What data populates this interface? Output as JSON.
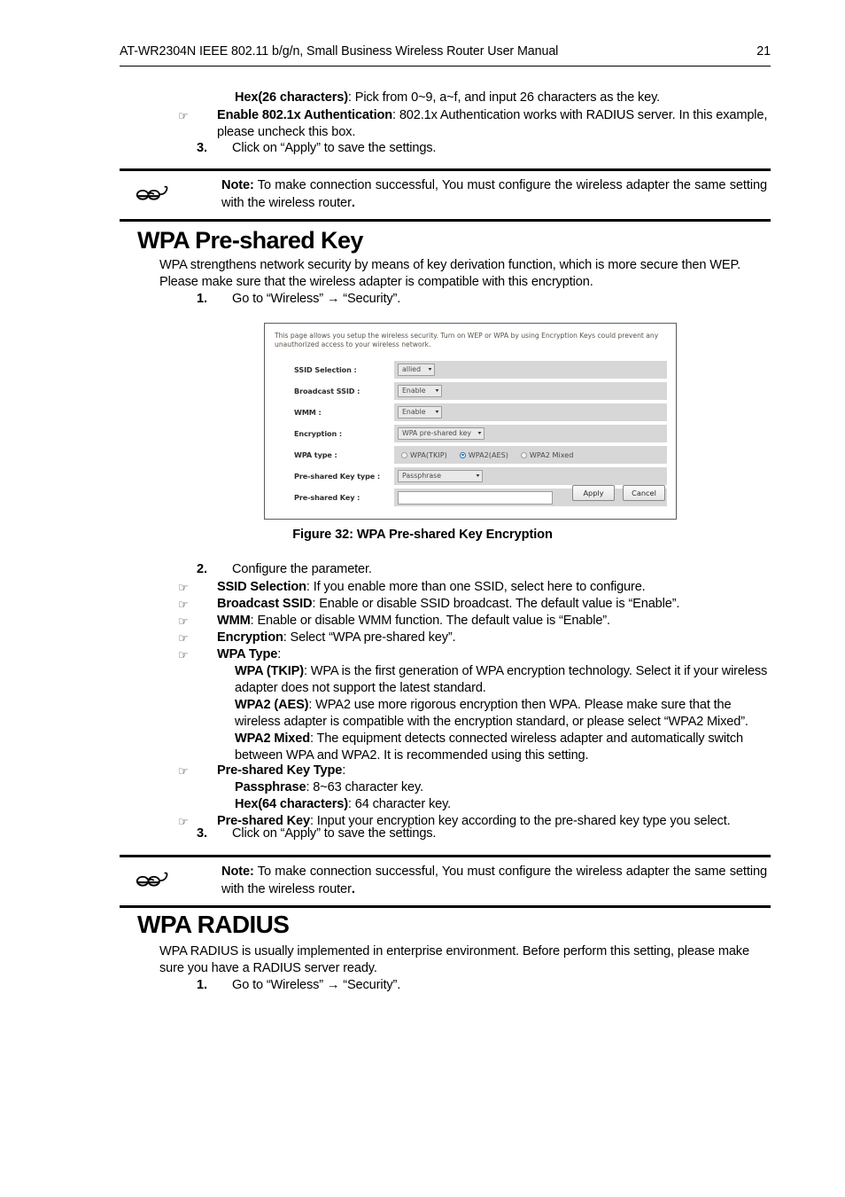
{
  "header": {
    "title": "AT-WR2304N IEEE 802.11 b/g/n, Small Business Wireless Router User Manual",
    "page_number": "21"
  },
  "top_section": {
    "hex_item_label": "Hex(26 characters)",
    "hex_item_text": ": Pick from 0~9, a~f, and input 26 characters as the key.",
    "enable_8021x_label": "Enable 802.1x Authentication",
    "enable_8021x_text": ": 802.1x Authentication works with RADIUS server. In this example, please uncheck this box.",
    "step3_num": "3.",
    "step3_text": "Click on “Apply” to save the settings."
  },
  "note1": {
    "lead": "Note:",
    "text": " To make connection successful, You must configure the wireless adapter the same setting with the wireless router",
    "tail": ".",
    "icon": "glasses-icon"
  },
  "wpa_psk_section": {
    "heading": "WPA Pre-shared Key",
    "intro": "WPA strengthens network security by means of key derivation function, which is more secure then WEP. Please make sure that the wireless adapter is compatible with this encryption.",
    "step1_num": "1.",
    "step1_text": "Go to “Wireless” → “Security”.",
    "step2_num": "2.",
    "step2_text": "Configure the parameter.",
    "step3_num": "3.",
    "step3_text": "Click on “Apply” to save the settings."
  },
  "figure": {
    "caption": "Figure 32: WPA Pre-shared Key Encryption",
    "description": "This page allows you setup the wireless security. Turn on WEP or WPA by using Encryption Keys could prevent any unauthorized access to your wireless network.",
    "fields": [
      {
        "label": "SSID Selection :",
        "type": "select",
        "value": "allied"
      },
      {
        "label": "Broadcast SSID :",
        "type": "select",
        "value": "Enable"
      },
      {
        "label": "WMM :",
        "type": "select",
        "value": "Enable"
      },
      {
        "label": "Encryption :",
        "type": "select",
        "value": "WPA pre-shared key"
      },
      {
        "label": "WPA type :",
        "type": "radio-group",
        "value": "WPA2(AES)"
      },
      {
        "label": "Pre-shared Key type :",
        "type": "select",
        "value": "Passphrase"
      },
      {
        "label": "Pre-shared Key :",
        "type": "text",
        "value": ""
      }
    ],
    "wpa_type_options": [
      {
        "label": "WPA(TKIP)",
        "selected": false
      },
      {
        "label": "WPA2(AES)",
        "selected": true
      },
      {
        "label": "WPA2 Mixed",
        "selected": false
      }
    ],
    "buttons": {
      "apply": "Apply",
      "cancel": "Cancel"
    },
    "caret_glyph": "▾"
  },
  "parameters": {
    "ssid_selection_label": "SSID Selection",
    "ssid_selection_text": ": If you enable more than one SSID, select here to configure.",
    "broadcast_ssid_label": "Broadcast SSID",
    "broadcast_ssid_text": ": Enable or disable SSID broadcast. The default value is “Enable”.",
    "wmm_label": "WMM",
    "wmm_text": ": Enable or disable WMM function. The default value is “Enable”.",
    "encryption_label": "Encryption",
    "encryption_text": ": Select “WPA pre-shared key”.",
    "wpa_type_label": "WPA Type",
    "wpa_type_text": ":",
    "wpa_tkip_label": "WPA (TKIP)",
    "wpa_tkip_text": ": WPA is the first generation of WPA encryption technology. Select it if your wireless adapter does not support the latest standard.",
    "wpa2_aes_label": "WPA2 (AES)",
    "wpa2_aes_text": ": WPA2 use more rigorous encryption then WPA. Please make sure that the wireless adapter is compatible with the encryption standard, or please select “WPA2 Mixed”.",
    "wpa2_mixed_label": "WPA2 Mixed",
    "wpa2_mixed_text": ": The equipment detects connected wireless adapter and automatically switch between WPA and WPA2. It is recommended using this setting.",
    "psk_type_label": "Pre-shared Key Type",
    "psk_type_text": ":",
    "passphrase_label": "Passphrase",
    "passphrase_text": ": 8~63 character key.",
    "hex64_label": "Hex(64 characters)",
    "hex64_text": ": 64 character key.",
    "psk_label": "Pre-shared Key",
    "psk_text": ": Input your encryption key according to the pre-shared key type you select."
  },
  "note2": {
    "lead": "Note:",
    "text": " To make connection successful, You must configure the wireless adapter the same setting with the wireless router",
    "tail": ".",
    "icon": "glasses-icon"
  },
  "wpa_radius_section": {
    "heading": "WPA RADIUS",
    "intro": "WPA RADIUS is usually implemented in enterprise environment. Before perform this setting, please make sure you have a RADIUS server ready.",
    "step1_num": "1.",
    "step1_text": "Go to “Wireless” → “Security”."
  },
  "glyphs": {
    "hand": "☞"
  }
}
